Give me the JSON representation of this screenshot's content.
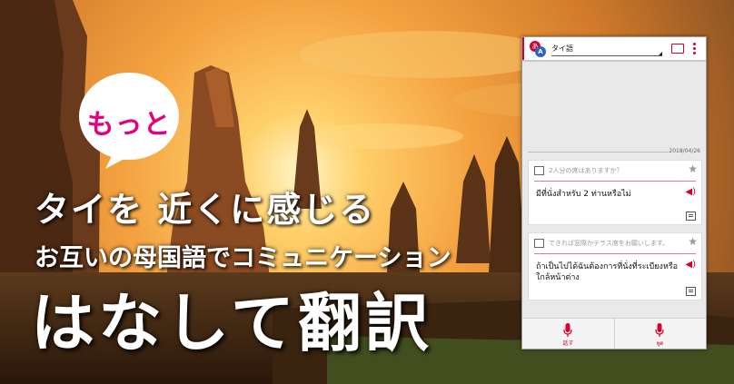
{
  "promo": {
    "bubble_text": "もっと",
    "headline": "タイを 近くに感じる",
    "subline": "お互いの母国語でコミュニケーション",
    "app_name": "はなして翻訳"
  },
  "app": {
    "language_selected": "タイ語",
    "date": "2018/04/26",
    "cards": [
      {
        "source": "2人分の席はありますか？",
        "translation": "มีที่นั่งสำหรับ 2 ท่านหรือไม่"
      },
      {
        "source": "できれば窓際かテラス席をお願いします。",
        "translation": "ถ้าเป็นไปได้ฉันต้องการที่นั่งที่ระเบียงหรือใกล้หน้าต่าง"
      }
    ],
    "bottom_left_label": "話す",
    "bottom_right_label": "พูด",
    "logo_letters": {
      "first": "あ",
      "second": "A"
    }
  },
  "colors": {
    "accent": "#d8002b",
    "bubble_text": "#e6007e",
    "sky_top": "#f0b35a",
    "sky_sun": "#fff4c0"
  }
}
